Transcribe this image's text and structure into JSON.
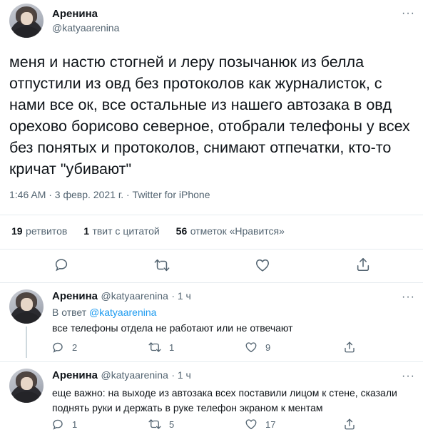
{
  "main_tweet": {
    "author_name": "Аренина",
    "author_handle": "@katyaarenina",
    "text": "меня и настю стогней и леру позычанюк из белла отпустили из овд без протоколов как журналисток, с нами все ок, все остальные из нашего автозака в овд орехово борисово северное, отобрали телефоны у всех без понятых и протоколов, снимают отпечатки, кто-то кричат \"убивают\"",
    "timestamp": "1:46 AM · 3 февр. 2021 г. · Twitter for iPhone",
    "stats": {
      "retweets_count": "19",
      "retweets_label": "ретвитов",
      "quotes_count": "1",
      "quotes_label": "твит с цитатой",
      "likes_count": "56",
      "likes_label": "отметок «Нравится»"
    }
  },
  "replies": [
    {
      "author_name": "Аренина",
      "author_handle": "@katyaarenina",
      "time": "· 1 ч",
      "reply_to_prefix": "В ответ",
      "reply_to_handle": "@katyaarenina",
      "text": "все телефоны отдела не работают или не отвечают",
      "reply_count": "2",
      "retweet_count": "1",
      "like_count": "9"
    },
    {
      "author_name": "Аренина",
      "author_handle": "@katyaarenina",
      "time": "· 1 ч",
      "text": "еще важно: на выходе из автозака всех поставили лицом к стене, сказали поднять руки и держать в руке телефон экраном к ментам",
      "reply_count": "1",
      "retweet_count": "5",
      "like_count": "17"
    }
  ],
  "icons": {
    "more": "more-dots-icon",
    "reply": "reply-bubble-icon",
    "retweet": "retweet-icon",
    "like": "heart-icon",
    "share": "share-icon"
  },
  "colors": {
    "text": "#0f1419",
    "secondary": "#536471",
    "link": "#1d9bf0",
    "divider": "#e6ecf0"
  }
}
